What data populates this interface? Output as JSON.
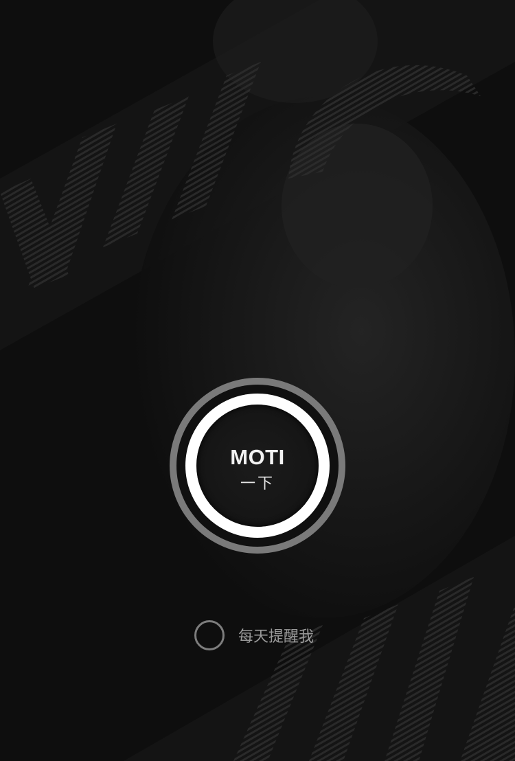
{
  "colors": {
    "background": "#0e0e0e",
    "outer_ring": "#7a7a7a",
    "inner_ring": "#ffffff",
    "label_text": "#f2f2f2",
    "reminder_text": "#9a9a9a"
  },
  "main_button": {
    "title": "MOTI",
    "subtitle": "一下"
  },
  "reminder": {
    "label": "每天提醒我",
    "checked": false
  }
}
